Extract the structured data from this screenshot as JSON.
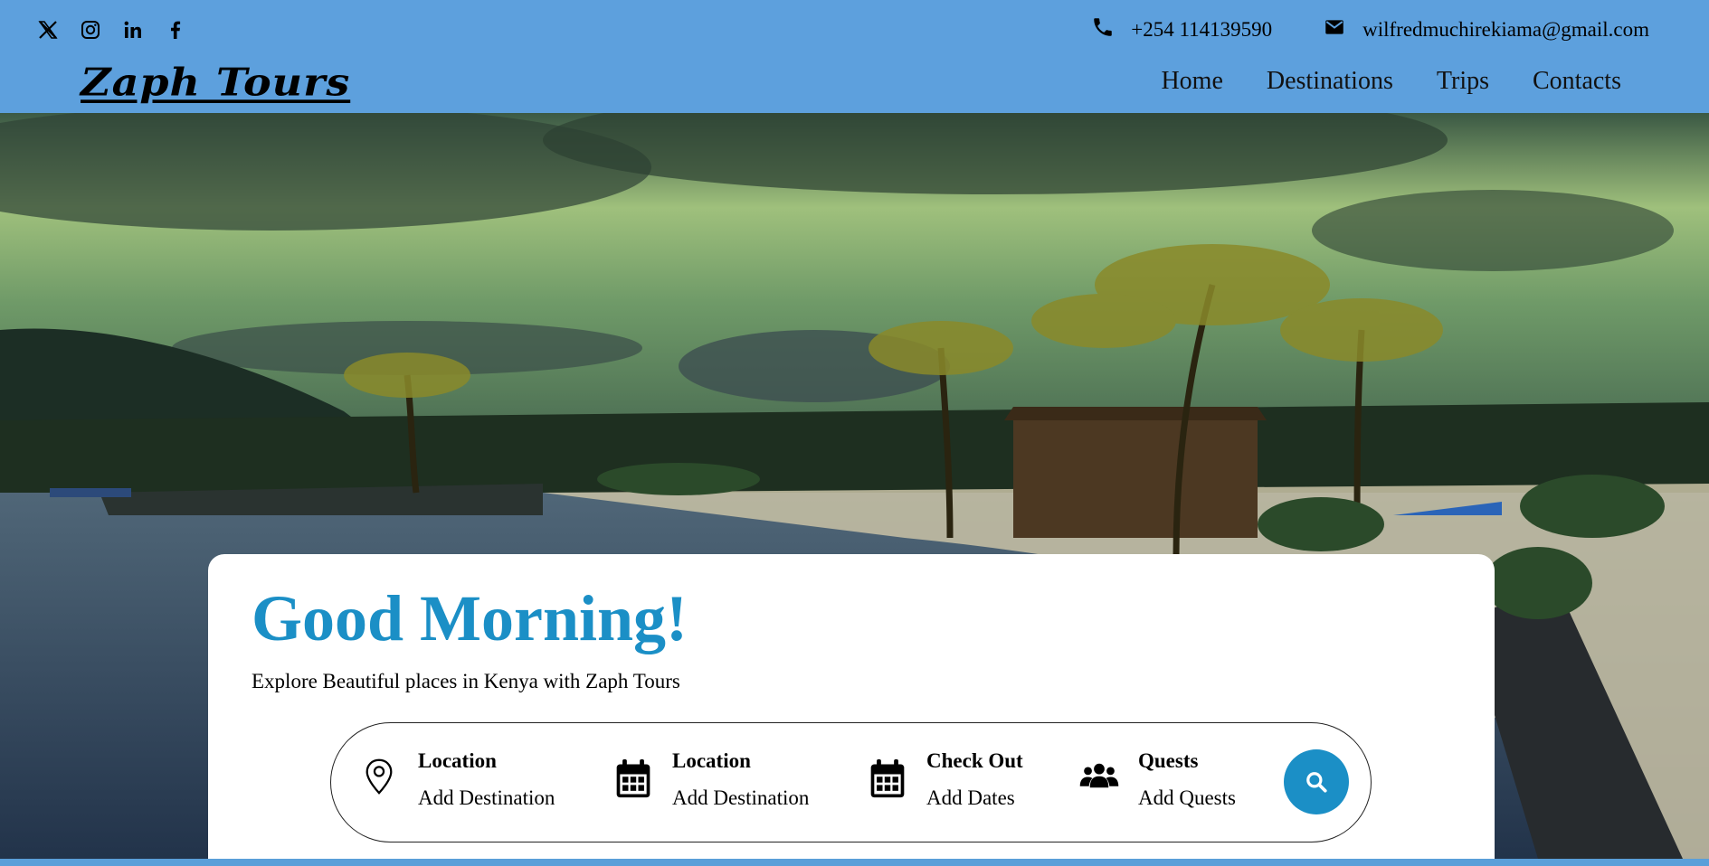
{
  "header": {
    "social_icons": [
      "x-twitter-icon",
      "instagram-icon",
      "linkedin-icon",
      "facebook-icon"
    ],
    "phone": "+254 114139590",
    "email": "wilfredmuchirekiama@gmail.com",
    "logo": "Zaph Tours",
    "nav": [
      "Home",
      "Destinations",
      "Trips",
      "Contacts"
    ]
  },
  "hero": {
    "greeting": "Good Morning!",
    "tagline": "Explore Beautiful places in Kenya with Zaph Tours"
  },
  "search": {
    "fields": [
      {
        "icon": "map-pin-icon",
        "label": "Location",
        "value": "Add Destination"
      },
      {
        "icon": "calendar-icon",
        "label": "Location",
        "value": "Add Destination"
      },
      {
        "icon": "calendar-icon",
        "label": "Check Out",
        "value": "Add Dates"
      },
      {
        "icon": "users-icon",
        "label": "Quests",
        "value": "Add Quests"
      }
    ],
    "button_icon": "search-icon"
  },
  "colors": {
    "header_bg": "#5da0dd",
    "accent": "#1b8fc6",
    "card_bg": "#ffffff"
  }
}
